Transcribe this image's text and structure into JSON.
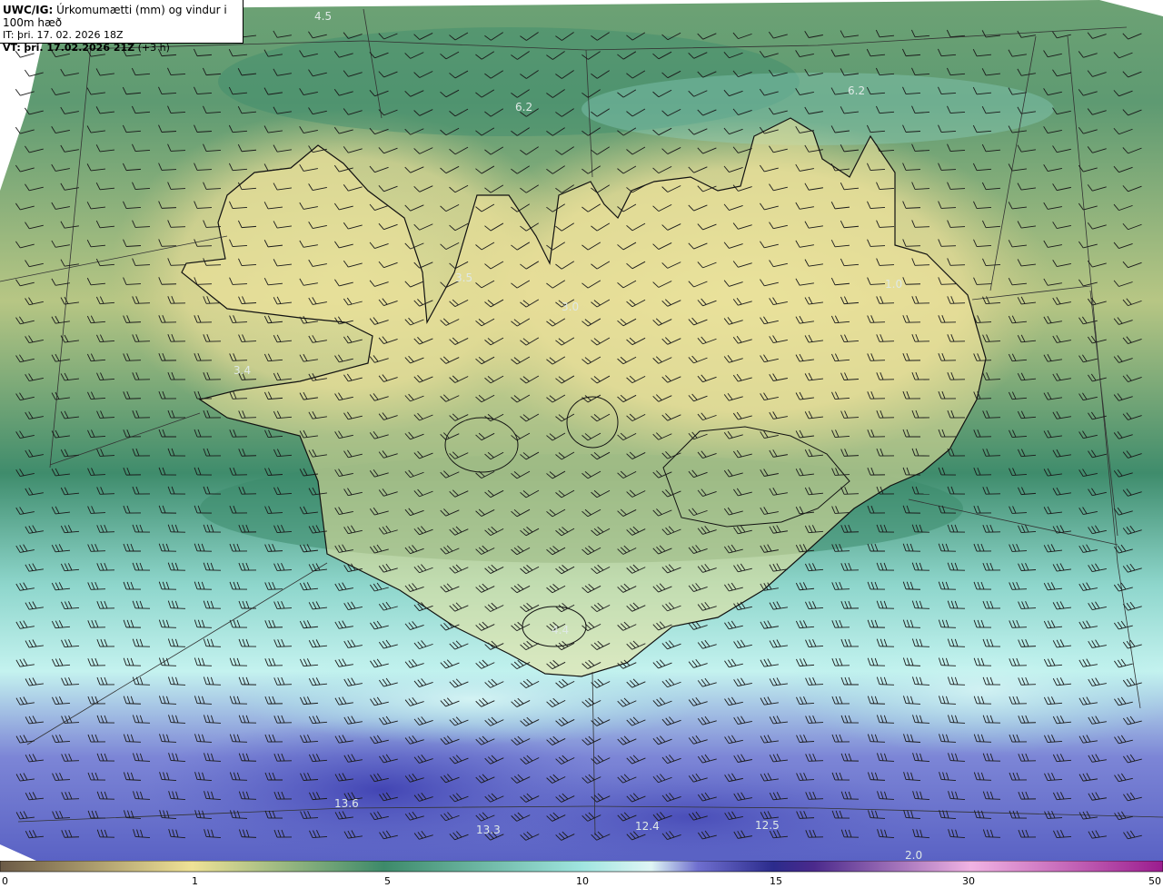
{
  "header": {
    "code": "UWC/IG:",
    "title": "Úrkomumætti (mm) og vindur i 100m hæð",
    "it_label": "IT:",
    "it_value": "þri. 17. 02. 2026 18Z",
    "vt_label": "VT:",
    "vt_value": "þri. 17.02.2026 21Z",
    "vt_offset": "(+3 h)"
  },
  "map_labels": [
    {
      "text": "4.5"
    },
    {
      "text": "6.2"
    },
    {
      "text": "6.2"
    },
    {
      "text": "3.5"
    },
    {
      "text": "3.0"
    },
    {
      "text": "1.0"
    },
    {
      "text": "3.4"
    },
    {
      "text": "4.4"
    },
    {
      "text": "13.6"
    },
    {
      "text": "13.3"
    },
    {
      "text": "12.4"
    },
    {
      "text": "12.5"
    },
    {
      "text": "2.0"
    }
  ],
  "colorbar": {
    "ticks": [
      "0",
      "1",
      "5",
      "10",
      "15",
      "30",
      "50"
    ],
    "colors": [
      "#6b5a46",
      "#c9b27a",
      "#efe296",
      "#3d8a6a",
      "#9fe5df",
      "#dff6f5",
      "#6f6fcf",
      "#2b2b8c",
      "#f1b3e3",
      "#9a1c8e"
    ]
  },
  "colors": {
    "land_yellow": "#e8e09a",
    "sea_green": "#3f8c6c",
    "light_cyan": "#a8ece6",
    "deep_blue": "#4a4fb8"
  }
}
